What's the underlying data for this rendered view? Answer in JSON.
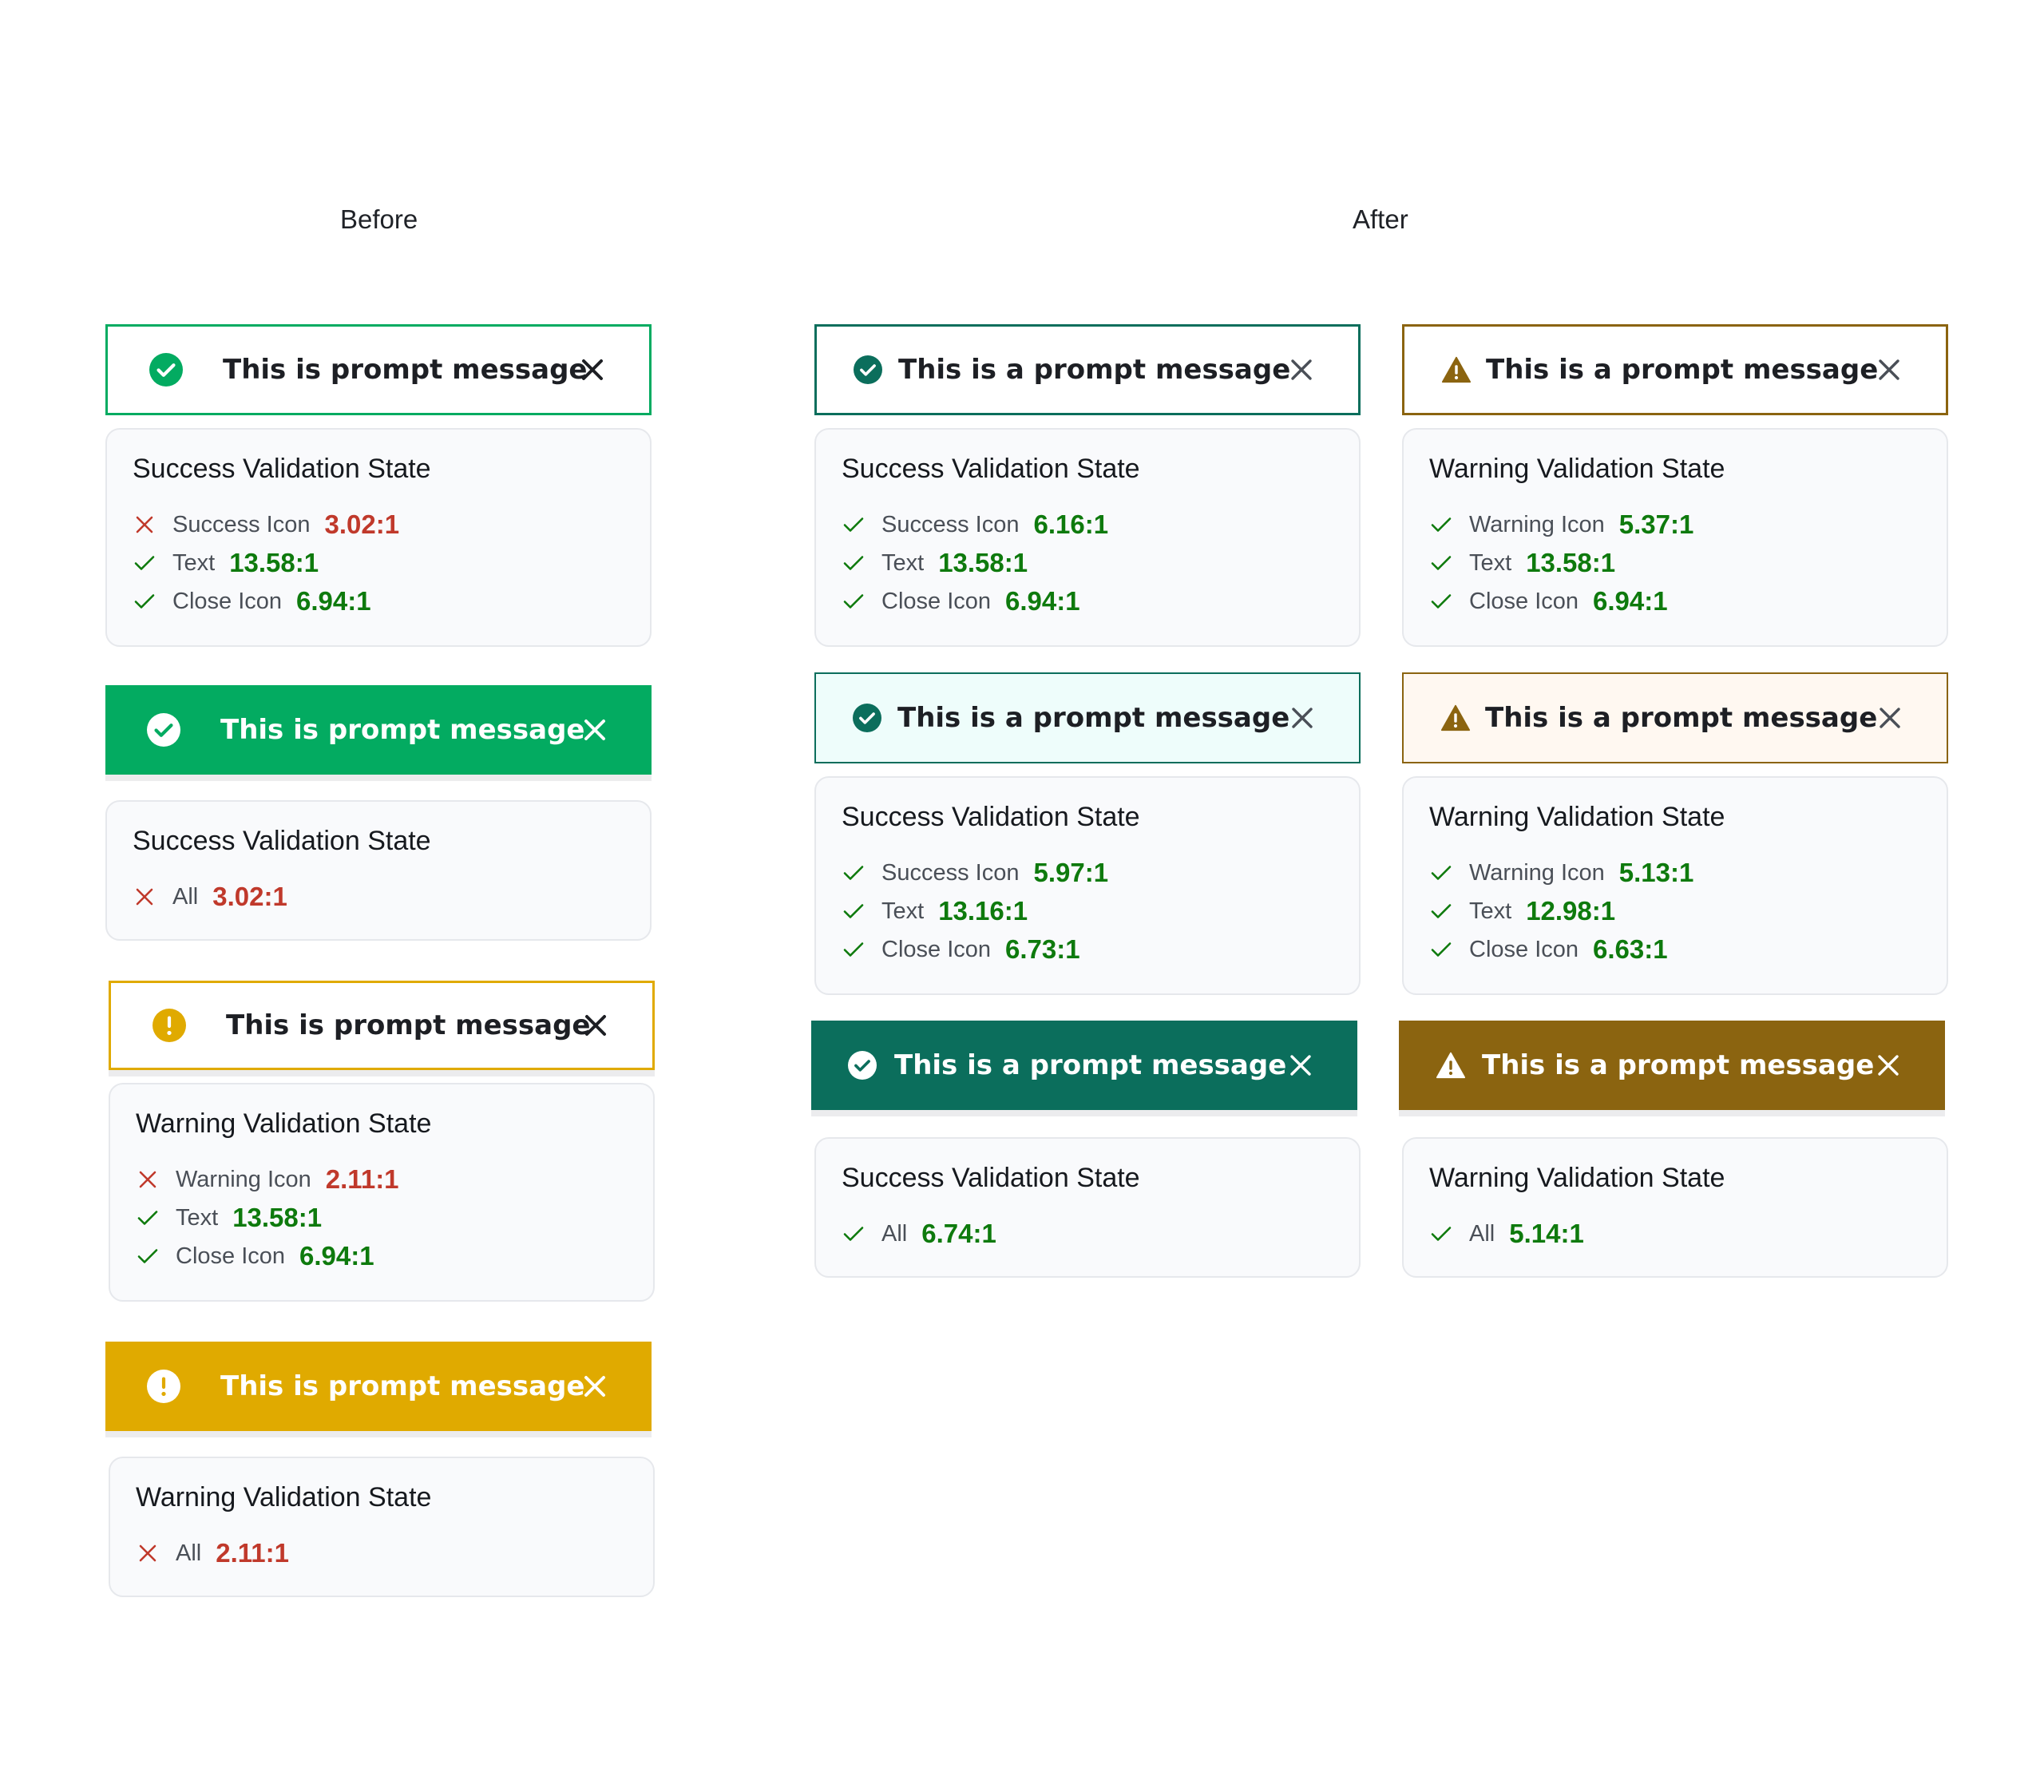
{
  "headings": {
    "before": "Before",
    "after": "After"
  },
  "colors": {
    "before_success": "#03ab61",
    "before_warning": "#e0aa00",
    "after_success": "#0b6e5c",
    "after_success_light_bg": "#eefdfb",
    "after_warning": "#8b6410",
    "after_warning_light_bg": "#fff8f1",
    "pass": "#0e7a0d",
    "fail": "#c0392b"
  },
  "before": {
    "banner_outline_success": {
      "message": "This is prompt message",
      "icon": "check-circle-icon"
    },
    "card_success_1": {
      "title": "Success Validation State",
      "rows": [
        {
          "status": "fail",
          "label": "Success Icon",
          "value": "3.02:1"
        },
        {
          "status": "pass",
          "label": "Text",
          "value": "13.58:1"
        },
        {
          "status": "pass",
          "label": "Close Icon",
          "value": "6.94:1"
        }
      ]
    },
    "banner_filled_success": {
      "message": "This is prompt message",
      "icon": "check-circle-icon"
    },
    "card_success_2": {
      "title": "Success Validation State",
      "rows": [
        {
          "status": "fail",
          "label": "All",
          "value": "3.02:1"
        }
      ]
    },
    "banner_outline_warning": {
      "message": "This is prompt message",
      "icon": "exclamation-circle-icon"
    },
    "card_warning_1": {
      "title": "Warning Validation State",
      "rows": [
        {
          "status": "fail",
          "label": "Warning Icon",
          "value": "2.11:1"
        },
        {
          "status": "pass",
          "label": "Text",
          "value": "13.58:1"
        },
        {
          "status": "pass",
          "label": "Close Icon",
          "value": "6.94:1"
        }
      ]
    },
    "banner_filled_warning": {
      "message": "This is prompt message",
      "icon": "exclamation-circle-icon"
    },
    "card_warning_2": {
      "title": "Warning Validation State",
      "rows": [
        {
          "status": "fail",
          "label": "All",
          "value": "2.11:1"
        }
      ]
    }
  },
  "after": {
    "success": {
      "banner_outline": {
        "message": "This is a prompt message",
        "icon": "check-circle-icon"
      },
      "card_1": {
        "title": "Success Validation State",
        "rows": [
          {
            "status": "pass",
            "label": "Success Icon",
            "value": "6.16:1"
          },
          {
            "status": "pass",
            "label": "Text",
            "value": "13.58:1"
          },
          {
            "status": "pass",
            "label": "Close Icon",
            "value": "6.94:1"
          }
        ]
      },
      "banner_light": {
        "message": "This is a prompt message",
        "icon": "check-circle-icon"
      },
      "card_2": {
        "title": "Success Validation State",
        "rows": [
          {
            "status": "pass",
            "label": "Success Icon",
            "value": "5.97:1"
          },
          {
            "status": "pass",
            "label": "Text",
            "value": "13.16:1"
          },
          {
            "status": "pass",
            "label": "Close Icon",
            "value": "6.73:1"
          }
        ]
      },
      "banner_filled": {
        "message": "This is a prompt message",
        "icon": "check-circle-icon"
      },
      "card_3": {
        "title": "Success Validation State",
        "rows": [
          {
            "status": "pass",
            "label": "All",
            "value": "6.74:1"
          }
        ]
      }
    },
    "warning": {
      "banner_outline": {
        "message": "This is a prompt message",
        "icon": "warning-triangle-icon"
      },
      "card_1": {
        "title": "Warning Validation State",
        "rows": [
          {
            "status": "pass",
            "label": "Warning Icon",
            "value": "5.37:1"
          },
          {
            "status": "pass",
            "label": "Text",
            "value": "13.58:1"
          },
          {
            "status": "pass",
            "label": "Close Icon",
            "value": "6.94:1"
          }
        ]
      },
      "banner_light": {
        "message": "This is a prompt message",
        "icon": "warning-triangle-icon"
      },
      "card_2": {
        "title": "Warning Validation State",
        "rows": [
          {
            "status": "pass",
            "label": "Warning Icon",
            "value": "5.13:1"
          },
          {
            "status": "pass",
            "label": "Text",
            "value": "12.98:1"
          },
          {
            "status": "pass",
            "label": "Close Icon",
            "value": "6.63:1"
          }
        ]
      },
      "banner_filled": {
        "message": "This is a prompt message",
        "icon": "warning-triangle-icon"
      },
      "card_3": {
        "title": "Warning Validation State",
        "rows": [
          {
            "status": "pass",
            "label": "All",
            "value": "5.14:1"
          }
        ]
      }
    }
  }
}
